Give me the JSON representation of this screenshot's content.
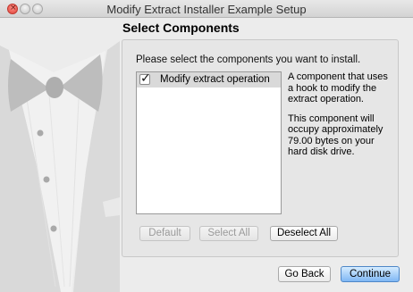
{
  "window": {
    "title": "Modify Extract Installer Example Setup"
  },
  "page": {
    "heading": "Select Components"
  },
  "components": {
    "instruction": "Please select the components you want to install.",
    "items": [
      {
        "label": "Modify extract operation",
        "checked": true
      }
    ],
    "description": [
      "A component that uses a hook to modify the extract operation.",
      "This component will occupy approximately 79.00 bytes on your hard disk drive."
    ],
    "buttons": {
      "default_label": "Default",
      "select_all_label": "Select All",
      "deselect_all_label": "Deselect All"
    }
  },
  "footer": {
    "back_label": "Go Back",
    "continue_label": "Continue"
  },
  "colors": {
    "close": "#e0443b",
    "default_button": "#7fb7f4"
  }
}
